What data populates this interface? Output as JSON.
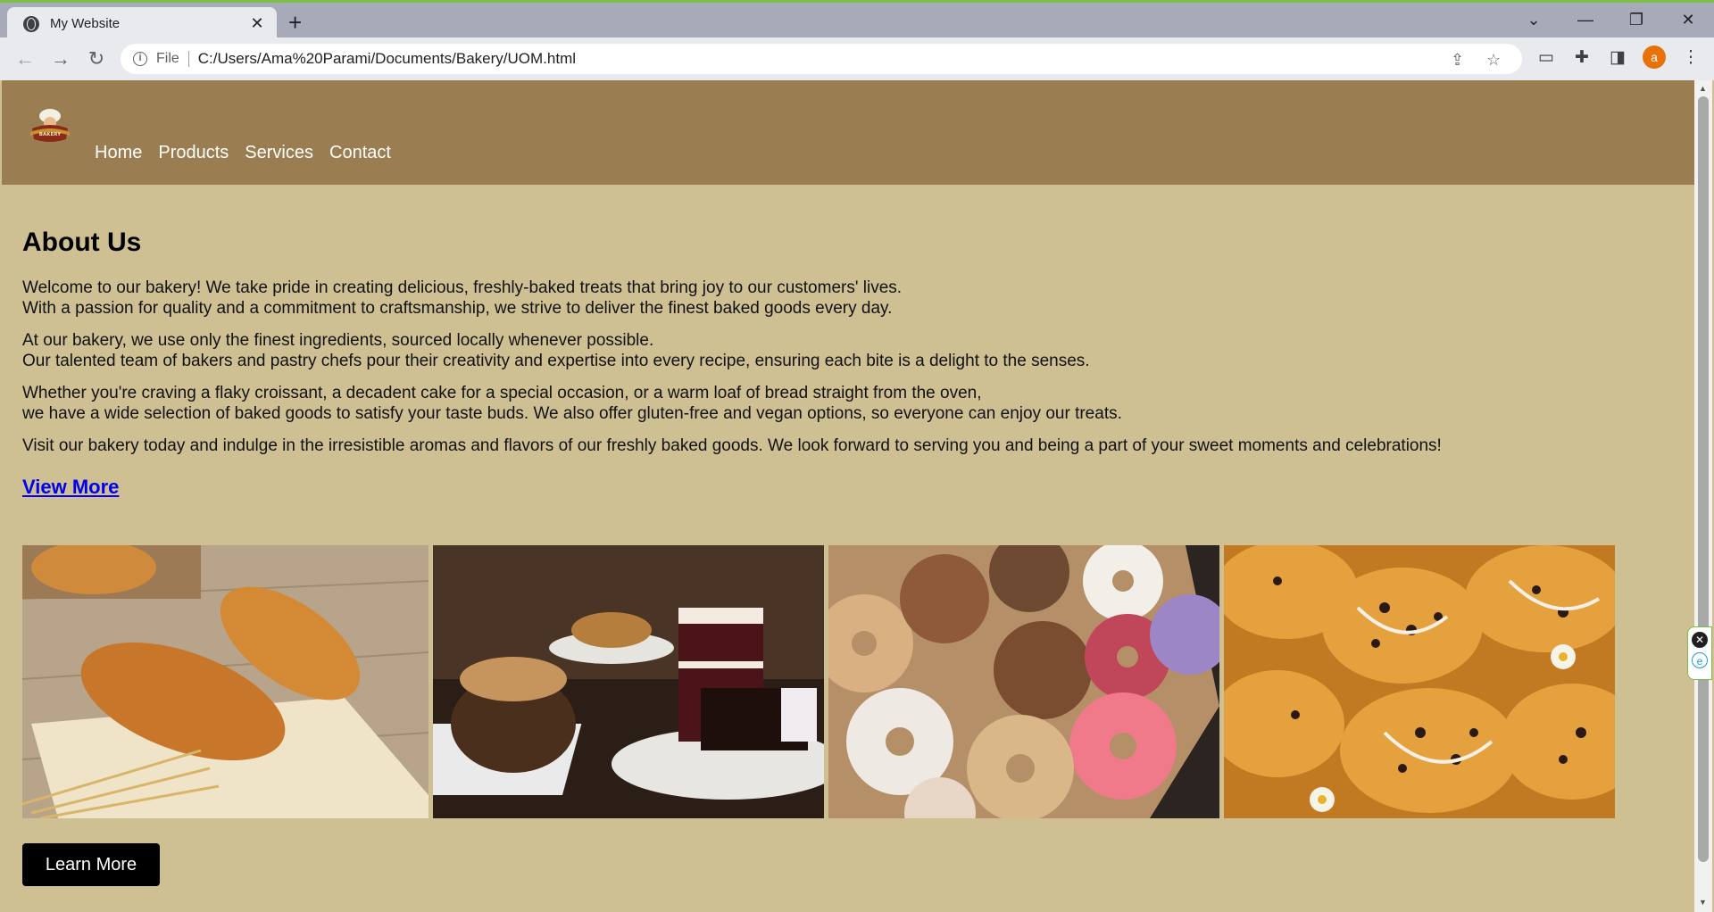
{
  "browser": {
    "tab_title": "My Website",
    "file_label": "File",
    "url": "C:/Users/Ama%20Parami/Documents/Bakery/UOM.html",
    "avatar_initial": "a"
  },
  "site": {
    "logo_text": "BAKERY",
    "nav": [
      "Home",
      "Products",
      "Services",
      "Contact"
    ]
  },
  "about": {
    "heading": "About Us",
    "paragraphs": [
      [
        "Welcome to our bakery! We take pride in creating delicious, freshly-baked treats that bring joy to our customers' lives.",
        "With a passion for quality and a commitment to craftsmanship, we strive to deliver the finest baked goods every day."
      ],
      [
        "At our bakery, we use only the finest ingredients, sourced locally whenever possible.",
        "Our talented team of bakers and pastry chefs pour their creativity and expertise into every recipe, ensuring each bite is a delight to the senses."
      ],
      [
        "Whether you're craving a flaky croissant, a decadent cake for a special occasion, or a warm loaf of bread straight from the oven,",
        "we have a wide selection of baked goods to satisfy your taste buds. We also offer gluten-free and vegan options, so everyone can enjoy our treats."
      ],
      [
        "Visit our bakery today and indulge in the irresistible aromas and flavors of our freshly baked goods. We look forward to serving you and being a part of your sweet moments and celebrations!"
      ]
    ],
    "view_more": "View More"
  },
  "gallery": [
    {
      "name": "croissants-image"
    },
    {
      "name": "cakes-image"
    },
    {
      "name": "donuts-image"
    },
    {
      "name": "pastries-image"
    }
  ],
  "learn_more": "Learn More"
}
